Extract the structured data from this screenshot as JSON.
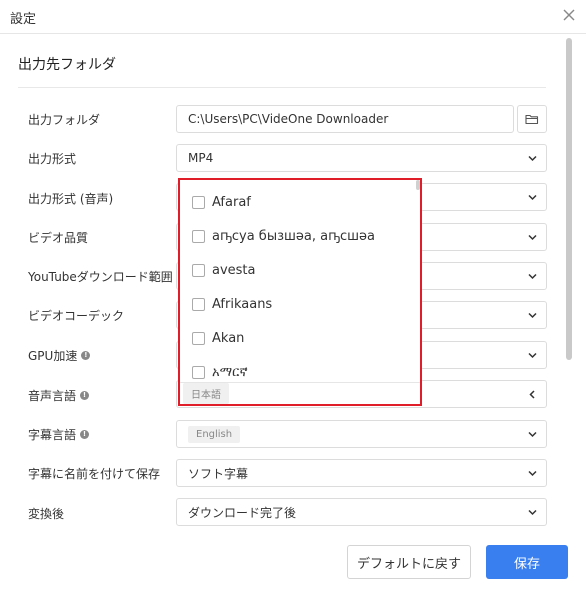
{
  "window": {
    "title": "設定"
  },
  "section": {
    "title": "出力先フォルダ"
  },
  "rows": {
    "output_folder": {
      "label": "出力フォルダ",
      "value": "C:\\Users\\PC\\VideOne Downloader"
    },
    "output_format": {
      "label": "出力形式",
      "value": "MP4"
    },
    "output_format_audio": {
      "label": "出力形式 (音声)"
    },
    "video_quality": {
      "label": "ビデオ品質"
    },
    "youtube_range": {
      "label": "YouTubeダウンロード範囲"
    },
    "video_codec": {
      "label": "ビデオコーデック"
    },
    "gpu": {
      "label": "GPU加速"
    },
    "audio_language": {
      "label": "音声言語",
      "tag": "日本語"
    },
    "subtitle_language": {
      "label": "字幕言語",
      "tag": "English"
    },
    "save_subtitle": {
      "label": "字幕に名前を付けて保存",
      "value": "ソフト字幕"
    },
    "after_convert": {
      "label": "変換後",
      "value": "ダウンロード完了後"
    }
  },
  "language_dropdown": {
    "items": [
      "Afaraf",
      "аҧсуа бызшәа, аҧсшәа",
      "avesta",
      "Afrikaans",
      "Akan",
      "አማርኛ"
    ],
    "selected_tag": "日本語"
  },
  "buttons": {
    "default_label": "デフォルトに戻す",
    "save_label": "保存"
  },
  "colors": {
    "accent": "#3a7fef",
    "highlight_border": "#e01e2a"
  }
}
